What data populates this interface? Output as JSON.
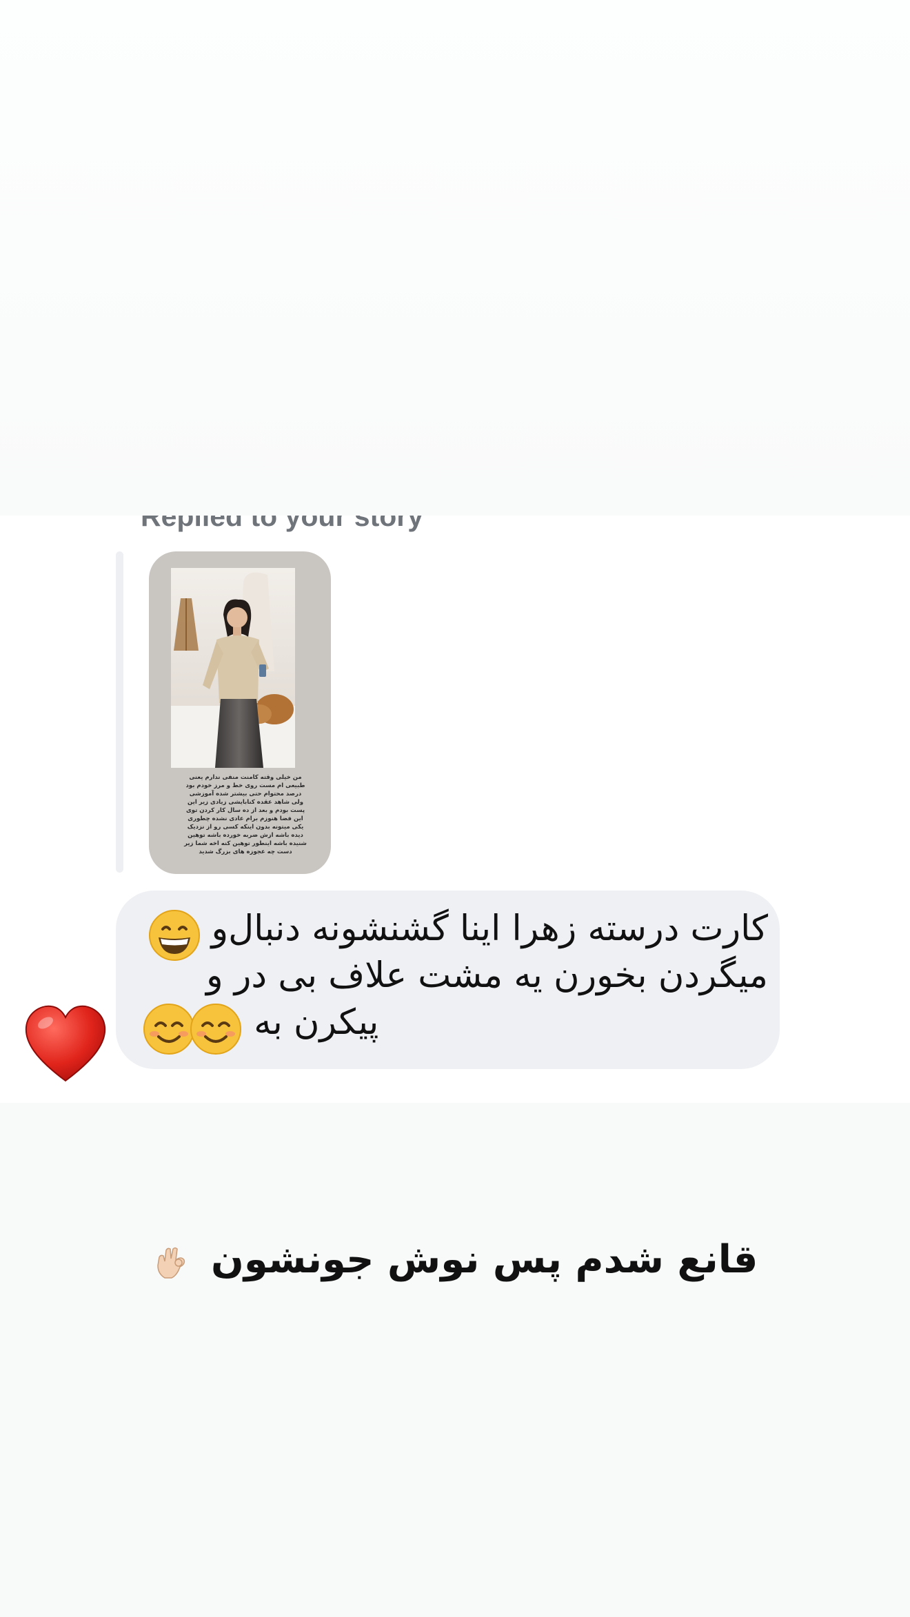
{
  "chat": {
    "reply_label": "Replied to your story",
    "story": {
      "caption": "من خیلی وقته کامنت منفی ندارم یعنی طبیعی ام مست روی خط و مرز خودم بود درصد محتوام حتی بیشتر شده آموزشی ولی شاهد عقده کنابایشی زیادی زیر این پست بودم و بعد از ده سال کار کردن توی این فضا هنوزم برام عادی نشده چطوری یکی میتونه بدون اینکه کسی رو از نزدیک دیده باشه ازش ضربه خورده باشه توهین شنیده باشه اینطور توهین کنه اخه شما زیر دست چه عجوزه های بزرگ شدید"
    },
    "message": {
      "line1": "کارت درسته زهرا اینا گشنشونه دنبال‌و",
      "line2": "میگردن بخورن یه مشت علاف بی در و",
      "line3": "پیکرن به ت"
    },
    "reaction": "heart-icon"
  },
  "overlay": {
    "caption": "قانع شدم پس نوش جونشون"
  },
  "colors": {
    "bubble": "#eff0f4",
    "label": "#6f737a",
    "heart": "#e0241b"
  }
}
